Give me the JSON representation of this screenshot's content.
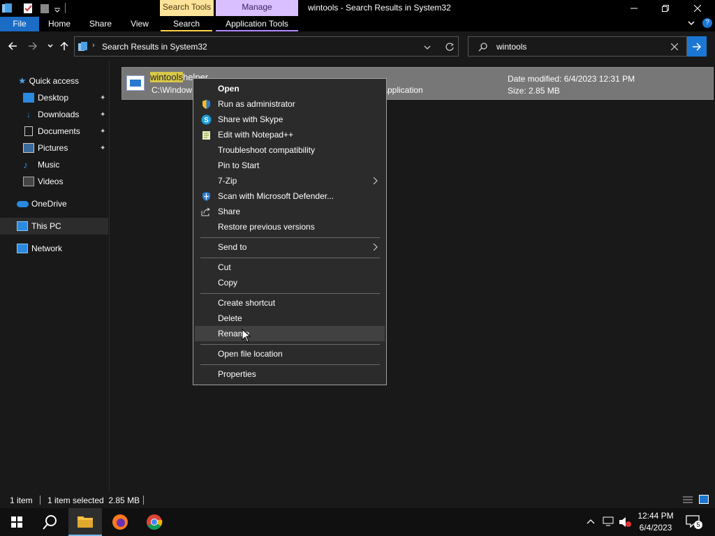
{
  "title_bar": {
    "contextual_tabs": [
      "Search Tools",
      "Manage"
    ],
    "window_title": "wintools - Search Results in System32"
  },
  "ribbon": {
    "tabs": [
      "File",
      "Home",
      "Share",
      "View",
      "Search",
      "Application Tools"
    ]
  },
  "address": {
    "path": "Search Results in System32",
    "search_value": "wintools"
  },
  "sidebar": {
    "quick_access": "Quick access",
    "items": [
      {
        "label": "Desktop",
        "icon": "desktop-icon",
        "pinned": true
      },
      {
        "label": "Downloads",
        "icon": "downloads-icon",
        "pinned": true
      },
      {
        "label": "Documents",
        "icon": "documents-icon",
        "pinned": true
      },
      {
        "label": "Pictures",
        "icon": "pictures-icon",
        "pinned": true
      },
      {
        "label": "Music",
        "icon": "music-icon",
        "pinned": false
      },
      {
        "label": "Videos",
        "icon": "videos-icon",
        "pinned": false
      }
    ],
    "onedrive": "OneDrive",
    "this_pc": "This PC",
    "network": "Network"
  },
  "result": {
    "name_highlight": "wintools",
    "name_rest": "helper",
    "path": "C:\\Window",
    "type": "Application",
    "date_modified": "Date modified: 6/4/2023 12:31 PM",
    "size": "Size: 2.85 MB"
  },
  "context_menu": {
    "items": [
      {
        "label": "Open",
        "bold": true
      },
      {
        "label": "Run as administrator",
        "icon": "shield-icon"
      },
      {
        "label": "Share with Skype",
        "icon": "skype-icon"
      },
      {
        "label": "Edit with Notepad++",
        "icon": "notepadpp-icon"
      },
      {
        "label": "Troubleshoot compatibility"
      },
      {
        "label": "Pin to Start"
      },
      {
        "label": "7-Zip",
        "submenu": true
      },
      {
        "label": "Scan with Microsoft Defender...",
        "icon": "defender-icon"
      },
      {
        "label": "Share",
        "icon": "share-icon"
      },
      {
        "label": "Restore previous versions"
      },
      {
        "label": "Send to",
        "submenu": true
      },
      {
        "label": "Cut"
      },
      {
        "label": "Copy"
      },
      {
        "label": "Create shortcut"
      },
      {
        "label": "Delete"
      },
      {
        "label": "Rename",
        "hover": true
      },
      {
        "label": "Open file location"
      },
      {
        "label": "Properties"
      }
    ]
  },
  "status_bar": {
    "count": "1 item",
    "selected": "1 item selected  2.85 MB"
  },
  "taskbar": {
    "time": "12:44 PM",
    "date": "6/4/2023",
    "notifications": "5"
  },
  "colors": {
    "accent": "#1a78d4",
    "search_tools": "#ffe49a",
    "manage": "#d9bfff"
  }
}
